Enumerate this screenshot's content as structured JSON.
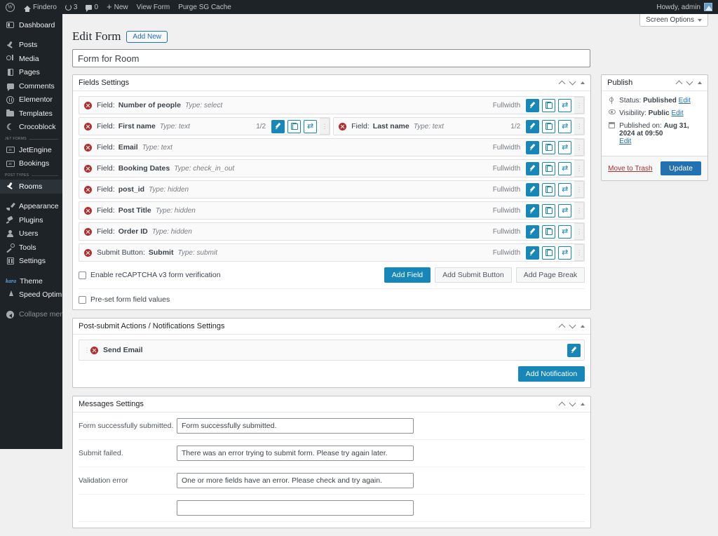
{
  "adminbar": {
    "logo_icon": "wordpress-logo-icon",
    "site_name": "Findero",
    "updates_count": "3",
    "comments_count": "0",
    "new_label": "New",
    "view_form_label": "View Form",
    "purge_cache_label": "Purge SG Cache",
    "howdy": "Howdy, admin"
  },
  "sidebar": {
    "items": [
      {
        "label": "Dashboard",
        "icon": "dashboard-icon",
        "glyph": "g-dash"
      },
      {
        "label": "Posts",
        "icon": "posts-pin-icon",
        "glyph": "g-pin"
      },
      {
        "label": "Media",
        "icon": "media-icon",
        "glyph": "g-media"
      },
      {
        "label": "Pages",
        "icon": "pages-icon",
        "glyph": "g-page"
      },
      {
        "label": "Comments",
        "icon": "comments-icon",
        "glyph": "g-comment"
      },
      {
        "label": "Elementor",
        "icon": "elementor-icon",
        "glyph": "g-elem"
      },
      {
        "label": "Templates",
        "icon": "templates-folder-icon",
        "glyph": "g-folder"
      },
      {
        "label": "Crocoblock",
        "icon": "crocoblock-moon-icon",
        "glyph": "g-croco"
      }
    ],
    "separator_1": "JET FORMS",
    "group_1": [
      {
        "label": "JetEngine",
        "icon": "jetengine-icon",
        "glyph": "g-jet"
      },
      {
        "label": "Bookings",
        "icon": "bookings-icon",
        "glyph": "g-jet"
      }
    ],
    "separator_2": "POST TYPES",
    "group_2": [
      {
        "label": "Rooms",
        "icon": "rooms-pin-icon",
        "glyph": "g-pin",
        "active": true
      }
    ],
    "group_3": [
      {
        "label": "Appearance",
        "icon": "appearance-brush-icon",
        "glyph": "g-brush"
      },
      {
        "label": "Plugins",
        "icon": "plugins-icon",
        "glyph": "g-plug"
      },
      {
        "label": "Users",
        "icon": "users-icon",
        "glyph": "g-user"
      },
      {
        "label": "Tools",
        "icon": "tools-wrench-icon",
        "glyph": "g-tools"
      },
      {
        "label": "Settings",
        "icon": "settings-icon",
        "glyph": "g-settings"
      }
    ],
    "theme_brand": "kara",
    "theme_label": "Theme",
    "group_4": [
      {
        "label": "Speed Optimizer",
        "icon": "speed-optimizer-icon",
        "glyph": "g-speed"
      }
    ],
    "collapse_label": "Collapse menu",
    "collapse_icon": "collapse-menu-icon"
  },
  "screen_options": {
    "label": "Screen Options",
    "caret_icon": "chevron-down-icon"
  },
  "page": {
    "title": "Edit Form",
    "add_new_label": "Add New",
    "form_title_value": "Form for Room"
  },
  "fields_settings": {
    "title": "Fields Settings",
    "controls": {
      "up_icon": "chevron-up-icon",
      "down_icon": "chevron-down-icon",
      "toggle_icon": "collapse-toggle-icon"
    },
    "rows": [
      {
        "prefix": "Field:",
        "name": "Number of people",
        "type": "Type: select",
        "width": "Fullwidth",
        "paired": false
      },
      {
        "prefix": "Field:",
        "name": "First name",
        "type": "Type: text",
        "width": "1/2",
        "paired": true,
        "pair": {
          "prefix": "Field:",
          "name": "Last name",
          "type": "Type: text",
          "width": "1/2"
        }
      },
      {
        "prefix": "Field:",
        "name": "Email",
        "type": "Type: text",
        "width": "Fullwidth",
        "paired": false
      },
      {
        "prefix": "Field:",
        "name": "Booking Dates",
        "type": "Type: check_in_out",
        "width": "Fullwidth",
        "paired": false
      },
      {
        "prefix": "Field:",
        "name": "post_id",
        "type": "Type: hidden",
        "width": "Fullwidth",
        "paired": false
      },
      {
        "prefix": "Field:",
        "name": "Post Title",
        "type": "Type: hidden",
        "width": "Fullwidth",
        "paired": false
      },
      {
        "prefix": "Field:",
        "name": "Order ID",
        "type": "Type: hidden",
        "width": "Fullwidth",
        "paired": false
      },
      {
        "prefix": "Submit Button:",
        "name": "Submit",
        "type": "Type: submit",
        "width": "Fullwidth",
        "paired": false
      }
    ],
    "recaptcha_label": "Enable reCAPTCHA v3 form verification",
    "add_field_label": "Add Field",
    "add_submit_label": "Add Submit Button",
    "add_page_break_label": "Add Page Break",
    "preset_label": "Pre-set form field values",
    "icons": {
      "delete": "delete-circle-icon",
      "edit": "pencil-edit-icon",
      "duplicate": "copy-duplicate-icon",
      "shuffle": "shuffle-move-icon",
      "drag": "drag-handle-icon"
    }
  },
  "post_submit": {
    "title": "Post-submit Actions / Notifications Settings",
    "rows": [
      {
        "name": "Send Email"
      }
    ],
    "add_notification_label": "Add Notification"
  },
  "messages_settings": {
    "title": "Messages Settings",
    "rows": [
      {
        "label": "Form successfully submitted.",
        "value": "Form successfully submitted."
      },
      {
        "label": "Submit failed.",
        "value": "There was an error trying to submit form. Please try again later."
      },
      {
        "label": "Validation error",
        "value": "One or more fields have an error. Please check and try again."
      },
      {
        "label": "",
        "value": ""
      }
    ]
  },
  "publish": {
    "title": "Publish",
    "status_label": "Status:",
    "status_value": "Published",
    "status_edit": "Edit",
    "visibility_label": "Visibility:",
    "visibility_value": "Public",
    "visibility_edit": "Edit",
    "published_label": "Published on:",
    "published_value": "Aug 31, 2024 at 09:50",
    "published_edit": "Edit",
    "trash_label": "Move to Trash",
    "update_label": "Update"
  },
  "colors": {
    "admin_dark": "#1d2327",
    "accent_blue": "#1787ba",
    "wp_blue": "#2271b1",
    "danger_red": "#b32d2e",
    "page_bg": "#f0f0f1"
  }
}
